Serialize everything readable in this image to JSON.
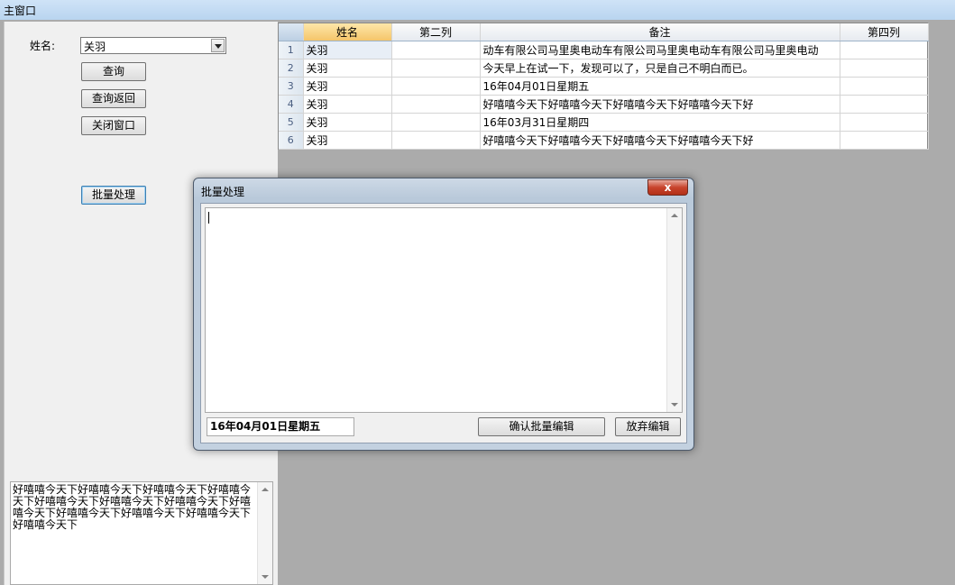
{
  "window": {
    "title": "主窗口"
  },
  "left": {
    "name_label": "姓名:",
    "name_value": "关羽",
    "query_button": "查询",
    "query_return_button": "查询返回",
    "close_window_button": "关闭窗口",
    "batch_button": "批量处理",
    "memo_text": "好嘻嘻今天下好嘻嘻今天下好嘻嘻今天下好嘻嘻今天下好嘻嘻今天下好嘻嘻今天下好嘻嘻今天下好嘻嘻今天下好嘻嘻今天下好嘻嘻今天下好嘻嘻今天下好嘻嘻今天下"
  },
  "grid": {
    "columns": [
      "姓名",
      "第二列",
      "备注",
      "第四列"
    ],
    "rows": [
      {
        "num": "1",
        "name": "关羽",
        "col2": "",
        "memo": "动车有限公司马里奥电动车有限公司马里奥电动车有限公司马里奥电动",
        "col4": ""
      },
      {
        "num": "2",
        "name": "关羽",
        "col2": "",
        "memo": "今天早上在试一下，发现可以了，只是自己不明白而已。",
        "col4": ""
      },
      {
        "num": "3",
        "name": "关羽",
        "col2": "",
        "memo": "16年04月01日星期五",
        "col4": ""
      },
      {
        "num": "4",
        "name": "关羽",
        "col2": "",
        "memo": "好嘻嘻今天下好嘻嘻今天下好嘻嘻今天下好嘻嘻今天下好",
        "col4": ""
      },
      {
        "num": "5",
        "name": "关羽",
        "col2": "",
        "memo": "16年03月31日星期四",
        "col4": ""
      },
      {
        "num": "6",
        "name": "关羽",
        "col2": "",
        "memo": "好嘻嘻今天下好嘻嘻今天下好嘻嘻今天下好嘻嘻今天下好",
        "col4": ""
      }
    ]
  },
  "dialog": {
    "title": "批量处理",
    "close_glyph": "x",
    "text_value": "",
    "date_value": "16年04月01日星期五",
    "confirm_button": "确认批量编辑",
    "cancel_button": "放弃编辑"
  }
}
